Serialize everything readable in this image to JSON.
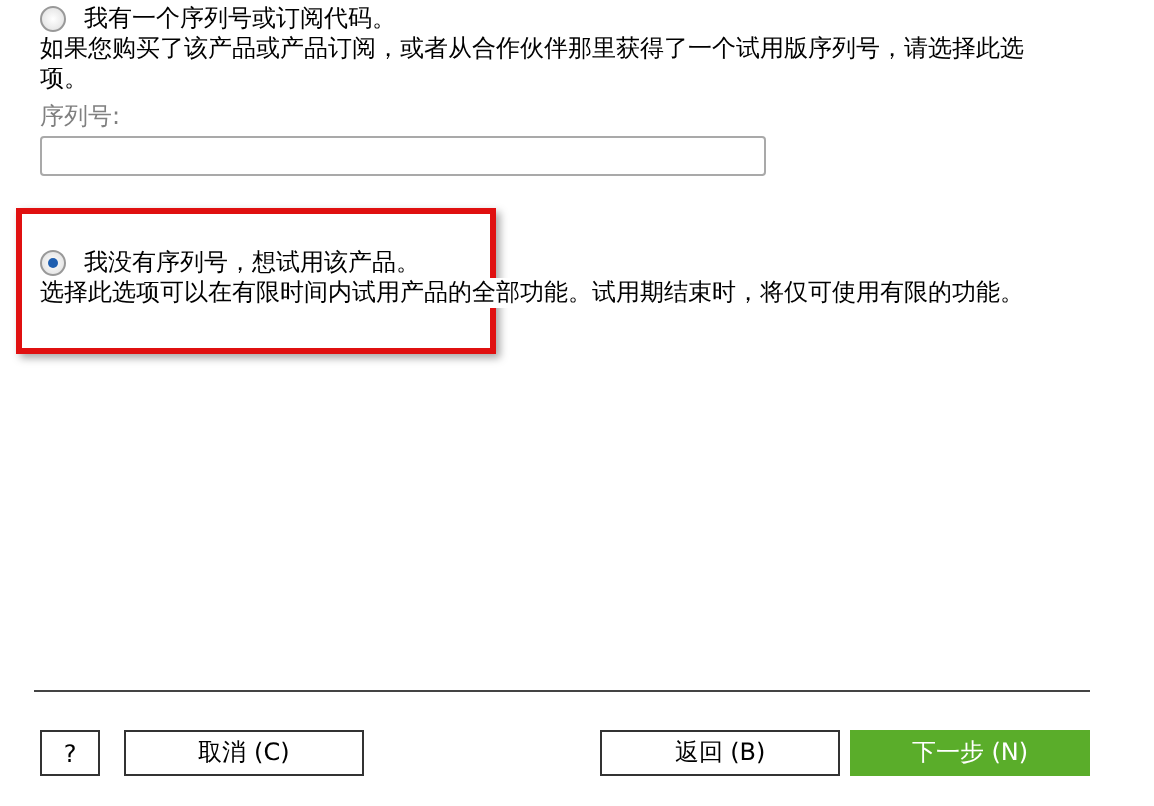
{
  "options": [
    {
      "label": "我有一个序列号或订阅代码。",
      "selected": false,
      "description": "如果您购买了该产品或产品订阅，或者从合作伙伴那里获得了一个试用版序列号，请选择此选项。",
      "field": {
        "label": "序列号:"
      }
    },
    {
      "label": "我没有序列号，想试用该产品。",
      "selected": true,
      "description": "选择此选项可以在有限时间内试用产品的全部功能。试用期结束时，将仅可使用有限的功能。"
    }
  ],
  "buttons": [
    {
      "label": "?",
      "kind": "plain"
    },
    {
      "label": "取消 (C)",
      "kind": "plain"
    },
    {
      "label": "返回 (B)",
      "kind": "plain"
    },
    {
      "label": "下一步 (N)",
      "kind": "primary"
    }
  ]
}
